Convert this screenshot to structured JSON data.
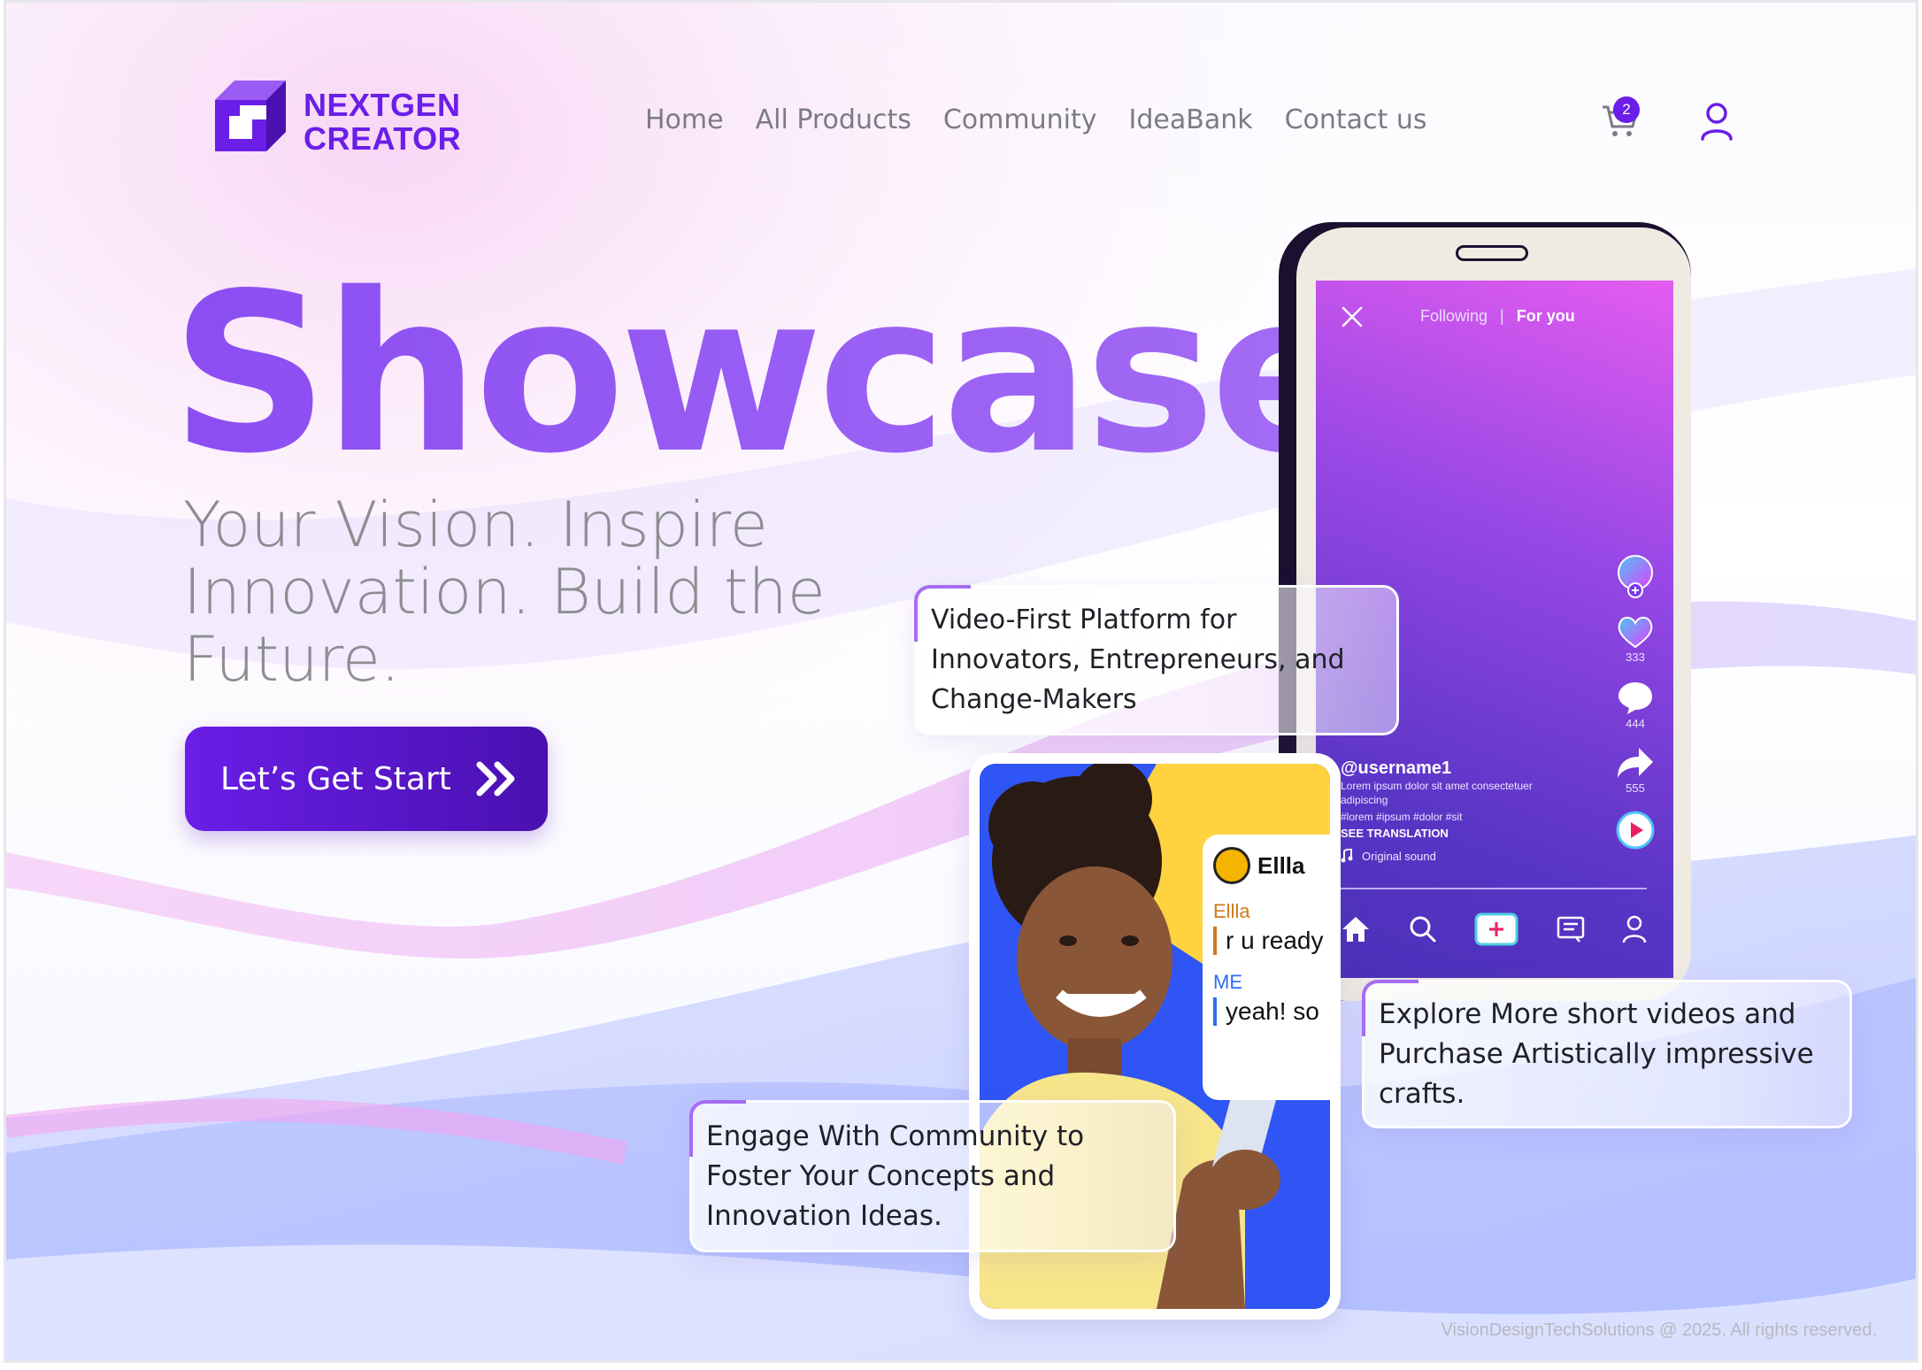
{
  "brand": {
    "name_line1": "NEXTGEN",
    "name_line2": "CREATOR",
    "color": "#6a1ee8"
  },
  "nav": {
    "items": [
      {
        "label": "Home"
      },
      {
        "label": "All Products"
      },
      {
        "label": "Community"
      },
      {
        "label": "IdeaBank"
      },
      {
        "label": "Contact us"
      }
    ]
  },
  "header_icons": {
    "cart_icon": "cart-icon",
    "cart_count": "2",
    "user_icon": "user-icon"
  },
  "hero": {
    "title": "Showcase",
    "subtitle": "Your Vision. Inspire Innovation. Build the Future.",
    "cta_label": "Let’s Get Start",
    "cta_icon": "double-chevron-right-icon"
  },
  "phone": {
    "tab_following": "Following",
    "tab_separator": "|",
    "tab_for_you": "For you",
    "likes": "333",
    "comments": "444",
    "shares": "555",
    "username": "@username1",
    "description": "Lorem ipsum dolor sit amet consectetuer adipiscing",
    "tags": "#lorem #ipsum #dolor #sit",
    "translate": "SEE TRANSLATION",
    "sound": "Original sound"
  },
  "cards": {
    "card1": "Video-First Platform for Innovators, Entrepreneurs, and Change-Makers",
    "card2": "Explore More short videos and Purchase Artistically impressive crafts.",
    "card3": "Engage With Community to Foster Your Concepts and Innovation Ideas."
  },
  "chat": {
    "header_name": "Ellla",
    "sender1": "Ellla",
    "message1": "r u ready",
    "sender2": "ME",
    "message2": "yeah! so"
  },
  "footer": {
    "text": "VisionDesignTechSolutions @ 2025. All rights reserved."
  },
  "colors": {
    "accent": "#6a1ee8",
    "title_gradient_start": "#8b4df2",
    "title_gradient_end": "#a46cf5"
  }
}
